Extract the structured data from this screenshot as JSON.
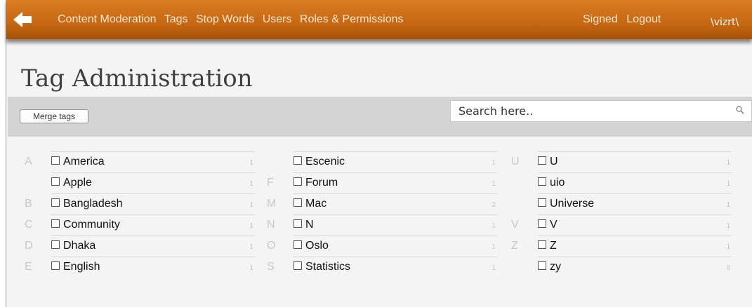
{
  "nav": {
    "items": [
      "Content Moderation",
      "Tags",
      "Stop Words",
      "Users",
      "Roles & Permissions"
    ],
    "right": [
      "Signed",
      "Logout"
    ],
    "logo": "\\vizrt\\"
  },
  "page": {
    "title": "Tag Administration"
  },
  "toolbar": {
    "merge_label": "Merge tags",
    "search_placeholder": "Search here.."
  },
  "columns": [
    [
      {
        "letter": "A",
        "name": "America",
        "count": "1"
      },
      {
        "letter": "",
        "name": "Apple",
        "count": "1"
      },
      {
        "letter": "B",
        "name": "Bangladesh",
        "count": "1"
      },
      {
        "letter": "C",
        "name": "Community",
        "count": "1"
      },
      {
        "letter": "D",
        "name": "Dhaka",
        "count": "1"
      },
      {
        "letter": "E",
        "name": "English",
        "count": "1"
      }
    ],
    [
      {
        "letter": "",
        "name": "Escenic",
        "count": "1"
      },
      {
        "letter": "F",
        "name": "Forum",
        "count": "1"
      },
      {
        "letter": "M",
        "name": "Mac",
        "count": "2"
      },
      {
        "letter": "N",
        "name": "N",
        "count": "1"
      },
      {
        "letter": "O",
        "name": "Oslo",
        "count": "1"
      },
      {
        "letter": "S",
        "name": "Statistics",
        "count": "1"
      }
    ],
    [
      {
        "letter": "U",
        "name": "U",
        "count": "1"
      },
      {
        "letter": "",
        "name": "uio",
        "count": "1"
      },
      {
        "letter": "",
        "name": "Universe",
        "count": "1"
      },
      {
        "letter": "V",
        "name": "V",
        "count": "1"
      },
      {
        "letter": "Z",
        "name": "Z",
        "count": "1"
      },
      {
        "letter": "",
        "name": "zy",
        "count": "9"
      }
    ]
  ],
  "colors": {
    "header": "#c96a14",
    "nav_text": "#fbe7d1",
    "toolbar": "#d4d4d4"
  }
}
